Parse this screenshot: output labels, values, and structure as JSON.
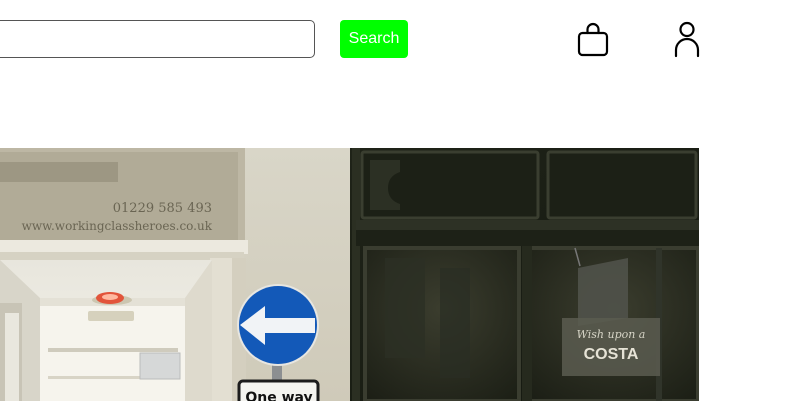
{
  "header": {
    "search": {
      "value": "",
      "placeholder": ""
    },
    "search_button_label": "Search",
    "icons": {
      "cart": "shopping-bag-icon",
      "account": "user-icon"
    },
    "accent_color": "#00ff00"
  },
  "hero": {
    "image_text": {
      "phone": "01229 585 493",
      "website": "www.workingclassheroes.co.uk",
      "road_sign": "One way",
      "window_script": "Wish upon a",
      "window_brand": "COSTA"
    }
  }
}
